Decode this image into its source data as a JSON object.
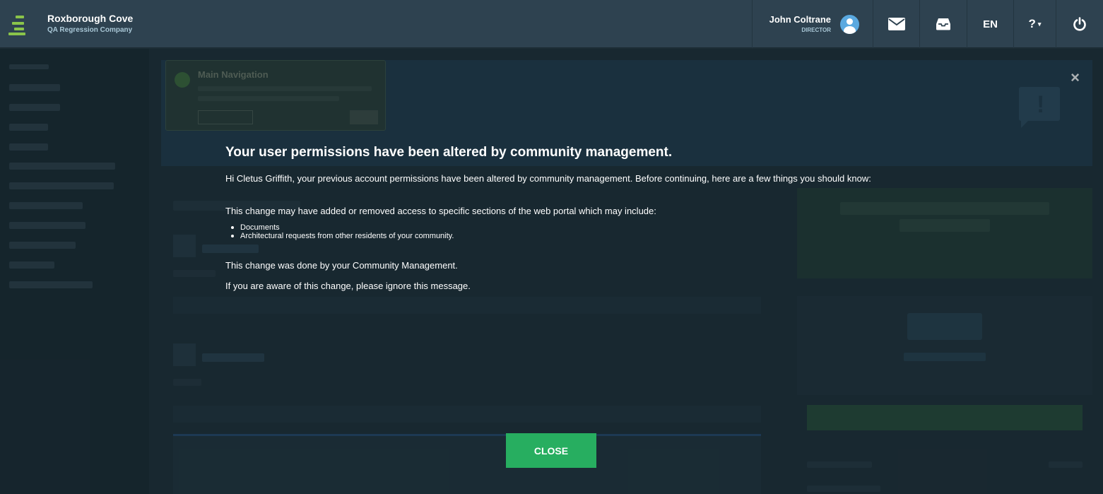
{
  "header": {
    "brand_name": "Roxborough Cove",
    "company": "QA Regression Company",
    "user_name": "John Coltrane",
    "user_role": "DIRECTOR",
    "language": "EN",
    "help_label": "?",
    "icons": {
      "mail": "envelope-icon",
      "inbox": "inbox-tray-icon",
      "power": "power-icon",
      "avatar": "user-avatar-icon",
      "help_caret": "caret-down-icon"
    }
  },
  "modal": {
    "title": "Your user permissions have been altered by community management.",
    "intro": "Hi Cletus Griffith, your previous account permissions have been altered by community management. Before continuing, here are a few things you should know:",
    "change_note": "This change may have added or removed access to specific sections of the web portal which may include:",
    "items": [
      "Documents",
      "Architectural requests from other residents of your community."
    ],
    "done_by": "This change was done by your Community Management.",
    "ignore_note": "If you are aware of this change, please ignore this message.",
    "close_label": "CLOSE"
  },
  "background": {
    "tour_title": "Main Navigation",
    "banner_close": "×",
    "banner_alert_icon": "speech-alert-icon"
  },
  "colors": {
    "header_bg": "#2e4250",
    "accent_green": "#27ae60",
    "logo_green": "#8ac44a",
    "avatar_blue": "#5aa9e0"
  }
}
